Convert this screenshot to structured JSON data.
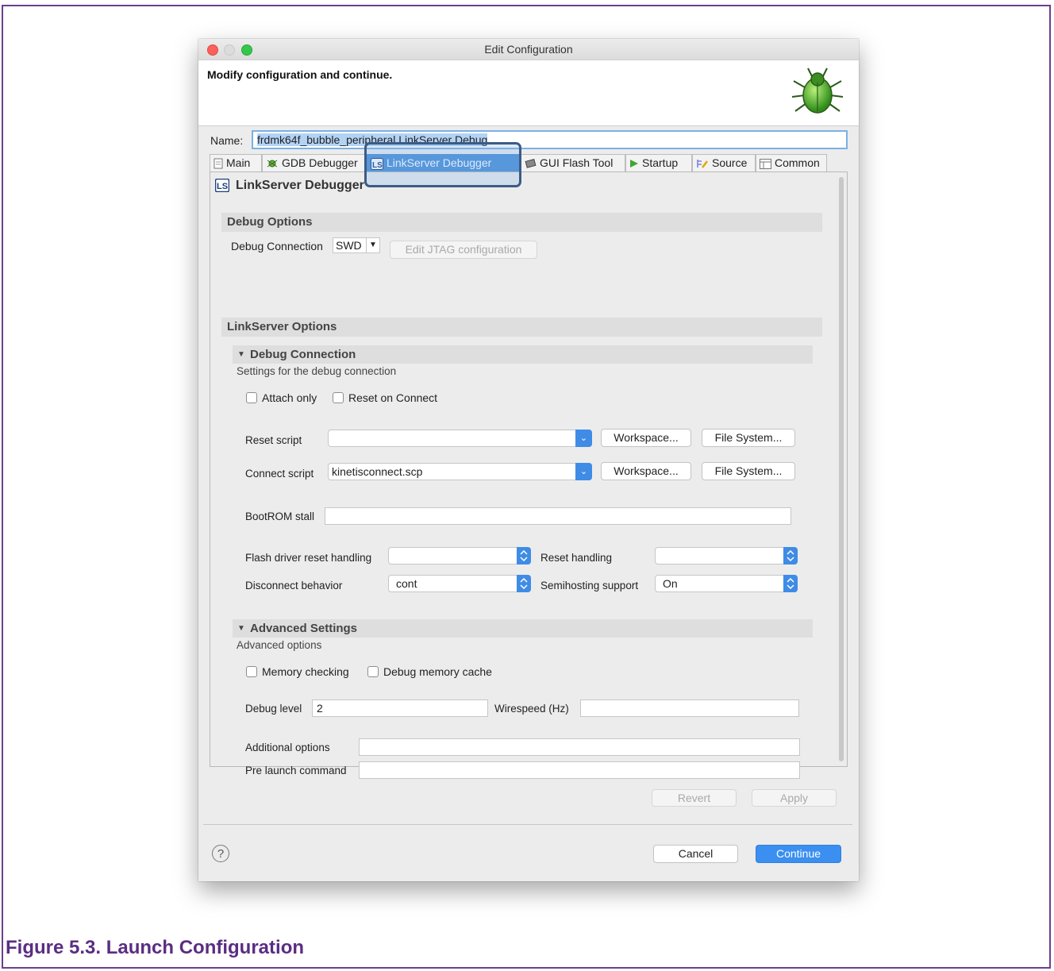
{
  "window": {
    "title": "Edit Configuration",
    "banner_message": "Modify configuration and continue."
  },
  "name_row": {
    "label": "Name:",
    "value": "frdmk64f_bubble_peripheral LinkServer Debug"
  },
  "tabs": [
    {
      "label": "Main",
      "icon": "page-icon"
    },
    {
      "label": "GDB Debugger",
      "icon": "bug-gear-icon"
    },
    {
      "label": "LinkServer Debugger",
      "icon": "ls-icon",
      "active": true
    },
    {
      "label": "GUI Flash Tool",
      "icon": "chip-icon"
    },
    {
      "label": "Startup",
      "icon": "play-icon"
    },
    {
      "label": "Source",
      "icon": "source-icon"
    },
    {
      "label": "Common",
      "icon": "table-icon"
    }
  ],
  "panel": {
    "heading": "LinkServer Debugger",
    "debug_options": {
      "title": "Debug Options",
      "connection_label": "Debug Connection",
      "connection_value": "SWD",
      "edit_jtag_button": "Edit JTAG configuration"
    },
    "linkserver_options": {
      "title": "LinkServer Options"
    },
    "debug_connection": {
      "title": "Debug Connection",
      "subtitle": "Settings for the debug connection",
      "attach_only": "Attach only",
      "reset_on_connect": "Reset on Connect",
      "reset_script_label": "Reset script",
      "reset_script_value": "",
      "connect_script_label": "Connect script",
      "connect_script_value": "kinetisconnect.scp",
      "workspace_button": "Workspace...",
      "file_system_button": "File System...",
      "bootrom_label": "BootROM stall",
      "bootrom_value": "",
      "flash_reset_label": "Flash driver reset handling",
      "flash_reset_value": "",
      "reset_handling_label": "Reset handling",
      "reset_handling_value": "",
      "disconnect_label": "Disconnect behavior",
      "disconnect_value": "cont",
      "semihosting_label": "Semihosting support",
      "semihosting_value": "On"
    },
    "advanced": {
      "title": "Advanced Settings",
      "subtitle": "Advanced options",
      "memory_checking": "Memory checking",
      "debug_memory_cache": "Debug memory cache",
      "debug_level_label": "Debug level",
      "debug_level_value": "2",
      "wirespeed_label": "Wirespeed (Hz)",
      "wirespeed_value": "",
      "additional_label": "Additional options",
      "additional_value": "",
      "prelaunch_label": "Pre launch command",
      "prelaunch_value": ""
    }
  },
  "footer": {
    "revert": "Revert",
    "apply": "Apply",
    "cancel": "Cancel",
    "continue": "Continue",
    "help": "?"
  },
  "caption": "Figure 5.3. Launch Configuration",
  "colors": {
    "accent": "#3a8ff0",
    "caption": "#5a2d82",
    "highlight_border": "#3b5c84"
  }
}
